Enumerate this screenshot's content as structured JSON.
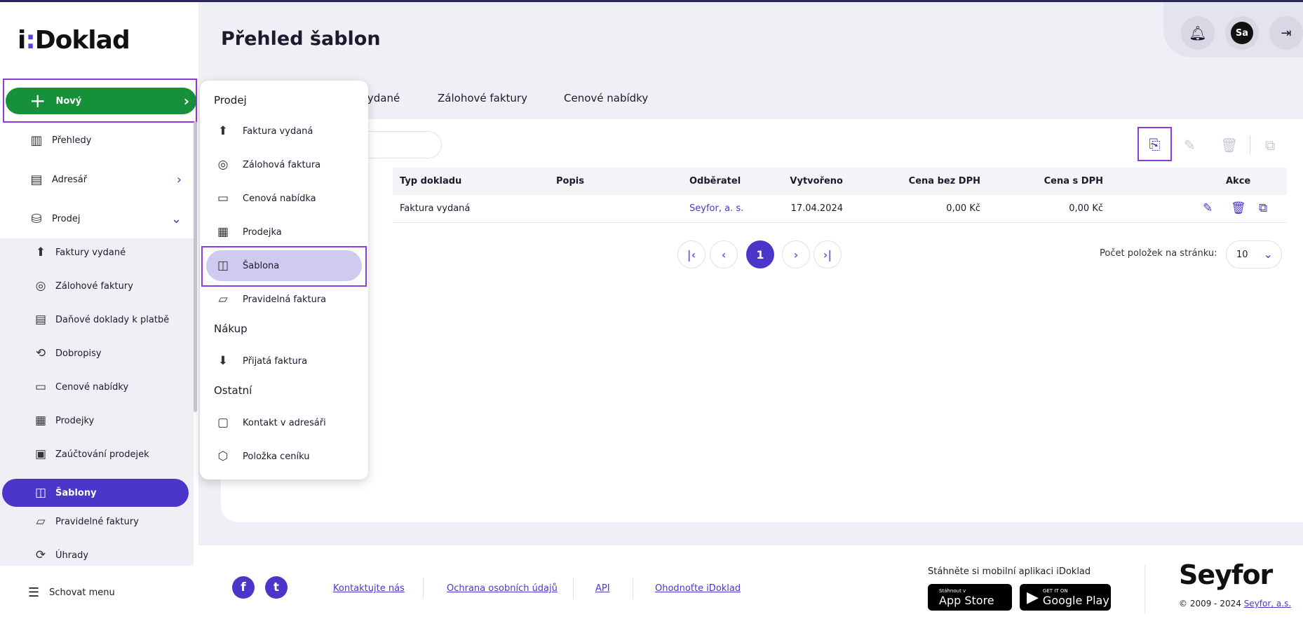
{
  "app": {
    "logo_text": "iDoklad"
  },
  "colors": {
    "accent": "#4a37c9",
    "new_button": "#17903a",
    "highlight_border": "#8a3ce0"
  },
  "sidebar": {
    "new_label": "Nový",
    "top_items": [
      {
        "label": "Přehledy",
        "icon": "chart-icon"
      },
      {
        "label": "Adresář",
        "icon": "address-book-icon"
      },
      {
        "label": "Prodej",
        "icon": "shopping-bag-icon"
      }
    ],
    "sub_items": [
      {
        "label": "Faktury vydané",
        "icon": "invoice-out-icon"
      },
      {
        "label": "Zálohové faktury",
        "icon": "advance-invoice-icon"
      },
      {
        "label": "Daňové doklady k platbě",
        "icon": "tax-document-icon"
      },
      {
        "label": "Dobropisy",
        "icon": "credit-note-icon"
      },
      {
        "label": "Cenové nabídky",
        "icon": "briefcase-icon"
      },
      {
        "label": "Prodejky",
        "icon": "cash-register-icon"
      },
      {
        "label": "Zaúčtování prodejek",
        "icon": "calendar-check-icon"
      },
      {
        "label": "Šablony",
        "icon": "template-icon",
        "active": true
      },
      {
        "label": "Pravidelné faktury",
        "icon": "recurring-invoice-icon"
      },
      {
        "label": "Úhrady",
        "icon": "payment-icon"
      }
    ],
    "hide_menu": "Schovat menu"
  },
  "header": {
    "title": "Přehled šablon",
    "avatar_initials": "Sa"
  },
  "tabs": [
    "vydané",
    "Zálohové faktury",
    "Cenové nabídky"
  ],
  "table": {
    "headers": [
      "Typ dokladu",
      "Popis",
      "Odběratel",
      "Vytvořeno",
      "Cena bez DPH",
      "Cena s DPH",
      "Akce"
    ],
    "rows": [
      {
        "type": "Faktura vydaná",
        "description": "",
        "customer": "Seyfor, a. s.",
        "created": "17.04.2024",
        "price_no_vat": "0,00 Kč",
        "price_vat": "0,00 Kč"
      }
    ]
  },
  "pagination": {
    "current_page": "1",
    "page_size_label": "Počet položek na stránku:",
    "page_size": "10"
  },
  "dropdown": {
    "sections": [
      {
        "title": "Prodej",
        "items": [
          "Faktura vydaná",
          "Zálohová faktura",
          "Cenová nabídka",
          "Prodejka",
          "Šablona",
          "Pravidelná faktura"
        ]
      },
      {
        "title": "Nákup",
        "items": [
          "Přijatá faktura"
        ]
      },
      {
        "title": "Ostatní",
        "items": [
          "Kontakt v adresáři",
          "Položka ceníku"
        ]
      }
    ],
    "highlighted": "Šablona"
  },
  "footer": {
    "links": [
      "Kontaktujte nás",
      "Ochrana osobních údajů",
      "API",
      "Ohodnoťte iDoklad"
    ],
    "app_text": "Stáhněte si mobilní aplikaci iDoklad",
    "app_store_small": "Stáhnout v",
    "app_store_large": "App Store",
    "google_small": "GET IT ON",
    "google_large": "Google Play",
    "brand": "Seyfor",
    "copyright": "© 2009 - 2024",
    "copyright_link": "Seyfor, a.s."
  }
}
